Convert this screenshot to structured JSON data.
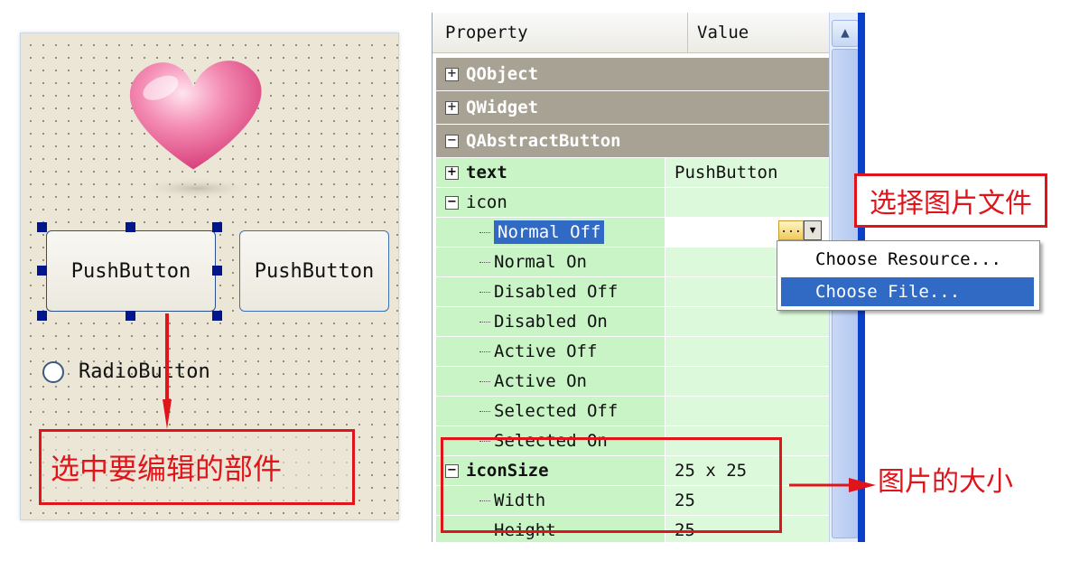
{
  "designer": {
    "button1_label": "PushButton",
    "button2_label": "PushButton",
    "radio_label": "RadioButton",
    "callout": "选中要编辑的部件"
  },
  "property_editor": {
    "header_property": "Property",
    "header_value": "Value",
    "groups": [
      "QObject",
      "QWidget",
      "QAbstractButton"
    ],
    "rows": [
      {
        "name": "text",
        "value": "PushButton"
      },
      {
        "name": "icon",
        "value": ""
      },
      {
        "name": "Normal Off",
        "value": ""
      },
      {
        "name": "Normal On",
        "value": ""
      },
      {
        "name": "Disabled Off",
        "value": ""
      },
      {
        "name": "Disabled On",
        "value": ""
      },
      {
        "name": "Active Off",
        "value": ""
      },
      {
        "name": "Active On",
        "value": ""
      },
      {
        "name": "Selected Off",
        "value": ""
      },
      {
        "name": "Selected On",
        "value": ""
      },
      {
        "name": "iconSize",
        "value": "25 x 25"
      },
      {
        "name": "Width",
        "value": "25"
      },
      {
        "name": "Height",
        "value": "25"
      }
    ],
    "dots_button": "..."
  },
  "context_menu": {
    "items": [
      "Choose Resource...",
      "Choose File..."
    ]
  },
  "annotations": {
    "choose_file": "选择图片文件",
    "icon_size": "图片的大小"
  },
  "colors": {
    "annotation_red": "#e0151b",
    "selection_blue": "#316ac5",
    "property_green": "#c8f4c6",
    "group_gray": "#a8a294"
  }
}
